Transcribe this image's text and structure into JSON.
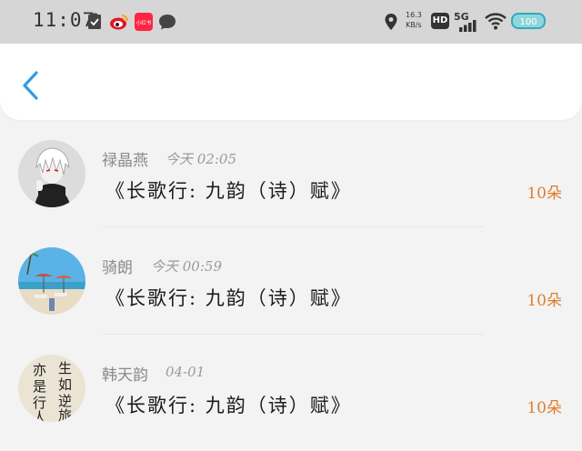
{
  "status_bar": {
    "time": "11:07",
    "net_speed_value": "16.3",
    "net_speed_unit": "KB/s",
    "hd_label": "HD",
    "network_type": "5G",
    "battery_label": "100",
    "icons": [
      "checklist-icon",
      "weibo-icon",
      "xiaohongshu-icon",
      "message-icon",
      "location-icon",
      "signal-icon",
      "wifi-icon",
      "battery-icon"
    ],
    "app_badge_text": "小红书"
  },
  "header": {
    "back_icon": "chevron-left-icon",
    "accent_color": "#2f9fe0"
  },
  "items": [
    {
      "name": "禄晶燕",
      "time": "今天 02:05",
      "title": "《长歌行: 九韵（诗）赋》",
      "count": "10朵",
      "avatar": "anime-avatar"
    },
    {
      "name": "骑朗",
      "time": "今天 00:59",
      "title": "《长歌行: 九韵（诗）赋》",
      "count": "10朵",
      "avatar": "beach-avatar"
    },
    {
      "name": "韩天韵",
      "time": "04-01",
      "title": "《长歌行: 九韵（诗）赋》",
      "count": "10朵",
      "avatar": "calligraphy-avatar",
      "avatar_text": [
        "生",
        "如",
        "逆",
        "旅",
        "亦",
        "是",
        "行",
        "人"
      ]
    }
  ],
  "colors": {
    "count": "#e07d2a",
    "name": "#8a8a8a",
    "title": "#1a1a1a"
  }
}
